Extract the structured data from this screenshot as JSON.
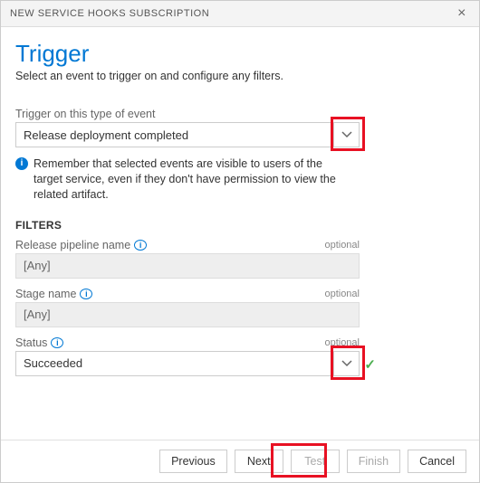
{
  "titlebar": {
    "title": "NEW SERVICE HOOKS SUBSCRIPTION"
  },
  "page": {
    "heading": "Trigger",
    "subtitle": "Select an event to trigger on and configure any filters."
  },
  "event": {
    "label": "Trigger on this type of event",
    "value": "Release deployment completed"
  },
  "info": {
    "text": "Remember that selected events are visible to users of the target service, even if they don't have permission to view the related artifact."
  },
  "filters": {
    "heading": "FILTERS",
    "optional_label": "optional",
    "pipeline": {
      "label": "Release pipeline name",
      "value": "[Any]"
    },
    "stage": {
      "label": "Stage name",
      "value": "[Any]"
    },
    "status": {
      "label": "Status",
      "value": "Succeeded"
    }
  },
  "footer": {
    "previous": "Previous",
    "next": "Next",
    "test": "Test",
    "finish": "Finish",
    "cancel": "Cancel"
  }
}
